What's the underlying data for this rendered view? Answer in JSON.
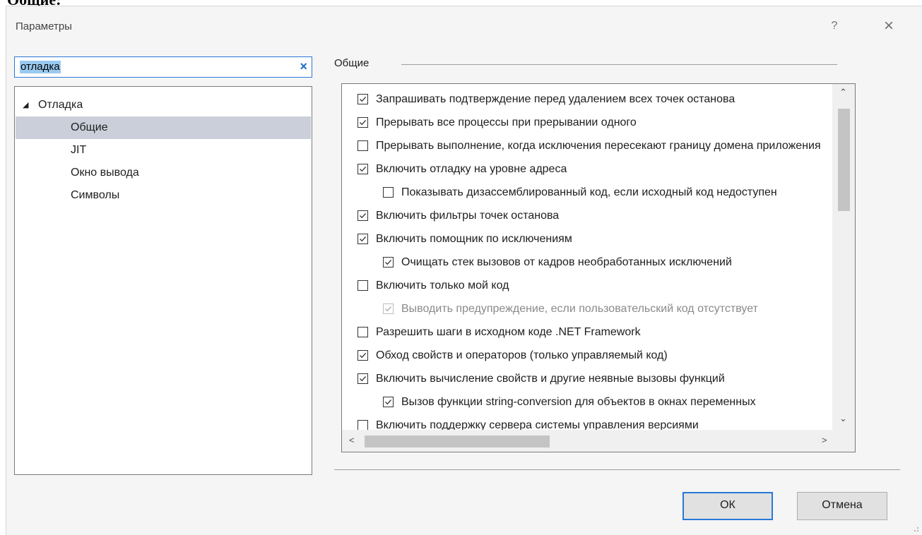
{
  "page_heading": "Общие:",
  "window": {
    "title": "Параметры",
    "help_label": "?",
    "close_label": "×"
  },
  "search": {
    "value": "отладка",
    "clear_label": "×"
  },
  "tree": {
    "expand_glyph": "◢",
    "items": [
      {
        "label": "Отладка",
        "level": 0,
        "expanded": true,
        "selected": false
      },
      {
        "label": "Общие",
        "level": 1,
        "selected": true
      },
      {
        "label": "JIT",
        "level": 1,
        "selected": false
      },
      {
        "label": "Окно вывода",
        "level": 1,
        "selected": false
      },
      {
        "label": "Символы",
        "level": 1,
        "selected": false
      }
    ]
  },
  "group": {
    "label": "Общие"
  },
  "options": [
    {
      "label": "Запрашивать подтверждение перед удалением всех точек останова",
      "checked": true,
      "level": 0,
      "enabled": true
    },
    {
      "label": "Прерывать все процессы при прерывании одного",
      "checked": true,
      "level": 0,
      "enabled": true
    },
    {
      "label": "Прерывать выполнение, когда исключения пересекают границу домена приложения",
      "checked": false,
      "level": 0,
      "enabled": true
    },
    {
      "label": "Включить отладку на уровне адреса",
      "checked": true,
      "level": 0,
      "enabled": true
    },
    {
      "label": "Показывать дизассемблированный код, если исходный код недоступен",
      "checked": false,
      "level": 1,
      "enabled": true
    },
    {
      "label": "Включить фильтры точек останова",
      "checked": true,
      "level": 0,
      "enabled": true
    },
    {
      "label": "Включить помощник по исключениям",
      "checked": true,
      "level": 0,
      "enabled": true
    },
    {
      "label": "Очищать стек вызовов от кадров необработанных исключений",
      "checked": true,
      "level": 1,
      "enabled": true
    },
    {
      "label": "Включить только мой код",
      "checked": false,
      "level": 0,
      "enabled": true
    },
    {
      "label": "Выводить предупреждение, если пользовательский код отсутствует",
      "checked": true,
      "level": 1,
      "enabled": false
    },
    {
      "label": "Разрешить шаги в исходном коде .NET Framework",
      "checked": false,
      "level": 0,
      "enabled": true
    },
    {
      "label": "Обход свойств и операторов (только управляемый код)",
      "checked": true,
      "level": 0,
      "enabled": true
    },
    {
      "label": "Включить вычисление свойств и другие неявные вызовы функций",
      "checked": true,
      "level": 0,
      "enabled": true
    },
    {
      "label": "Вызов функции string-conversion для объектов в окнах переменных",
      "checked": true,
      "level": 1,
      "enabled": true
    },
    {
      "label": "Включить поддержку сервера системы управления версиями",
      "checked": false,
      "level": 0,
      "enabled": true
    }
  ],
  "scrollbar": {
    "up_glyph": "⌃",
    "down_glyph": "⌄",
    "left_glyph": "<",
    "right_glyph": ">"
  },
  "buttons": {
    "ok_label": "ОК",
    "cancel_label": "Отмена"
  },
  "colors": {
    "accent": "#2978d8",
    "selection": "#cbcfda",
    "search_highlight": "#99c9ef"
  }
}
